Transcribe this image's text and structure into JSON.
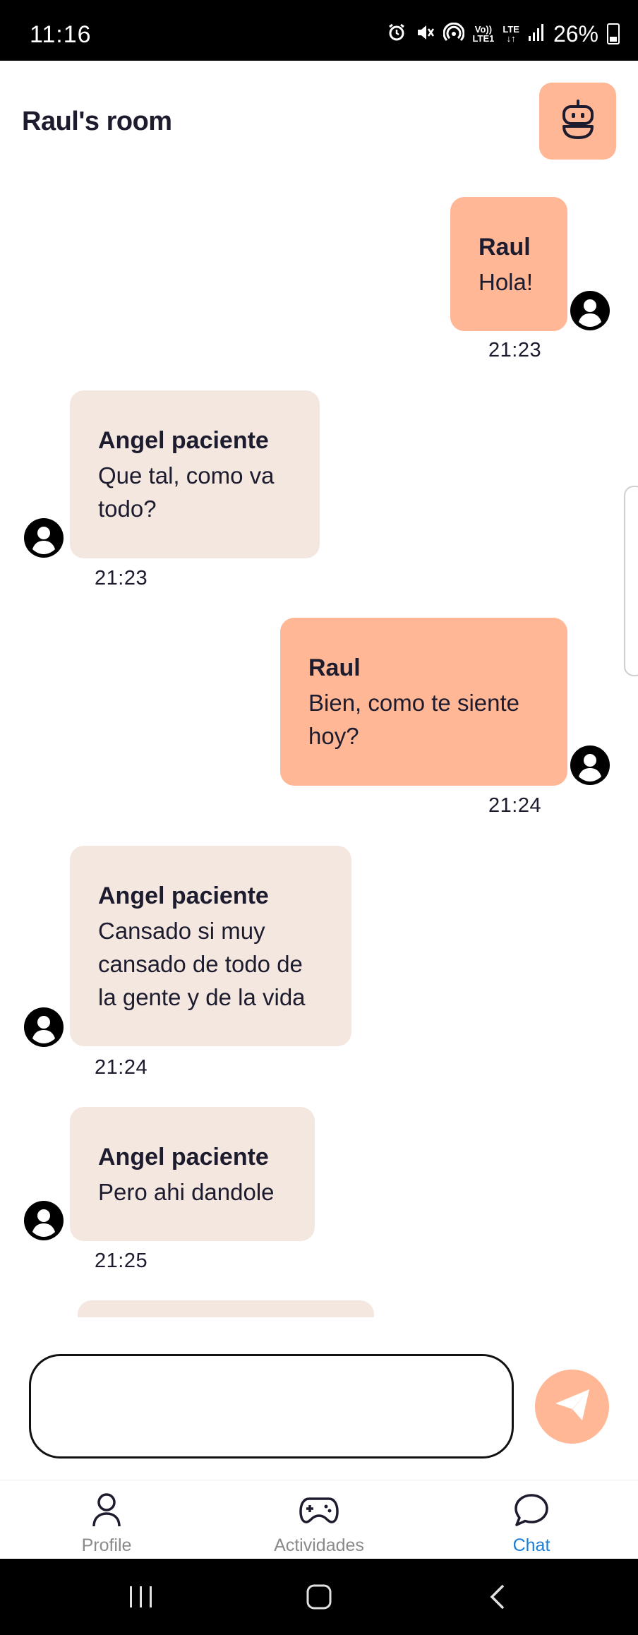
{
  "status_bar": {
    "time": "11:16",
    "network_top": "Vo))",
    "network_bottom": "LTE1",
    "lte_top": "LTE",
    "lte_bottom": "↓↑",
    "battery": "26%"
  },
  "header": {
    "title": "Raul's room",
    "bot_icon": "robot-icon"
  },
  "messages": [
    {
      "side": "sent",
      "name": "Raul",
      "text": "Hola!",
      "time": "21:23"
    },
    {
      "side": "received",
      "name": "Angel paciente",
      "text": "Que tal, como va todo?",
      "time": "21:23"
    },
    {
      "side": "sent",
      "name": "Raul",
      "text": "Bien, como te siente hoy?",
      "time": "21:24"
    },
    {
      "side": "received",
      "name": "Angel paciente",
      "text": "Cansado si muy cansado de todo de la gente y de la vida",
      "time": "21:24"
    },
    {
      "side": "received",
      "name": "Angel paciente",
      "text": "Pero ahi dandole",
      "time": "21:25"
    }
  ],
  "composer": {
    "value": "",
    "send_icon": "send-icon"
  },
  "bottom_nav": {
    "items": [
      {
        "label": "Profile",
        "icon": "person-icon",
        "active": false
      },
      {
        "label": "Actividades",
        "icon": "gamepad-icon",
        "active": false
      },
      {
        "label": "Chat",
        "icon": "chat-bubble-icon",
        "active": true
      }
    ]
  },
  "colors": {
    "accent": "#ffb796",
    "received_bubble": "#f3e7e0",
    "active_tab": "#1c7ed6",
    "text": "#1d1b2e"
  }
}
